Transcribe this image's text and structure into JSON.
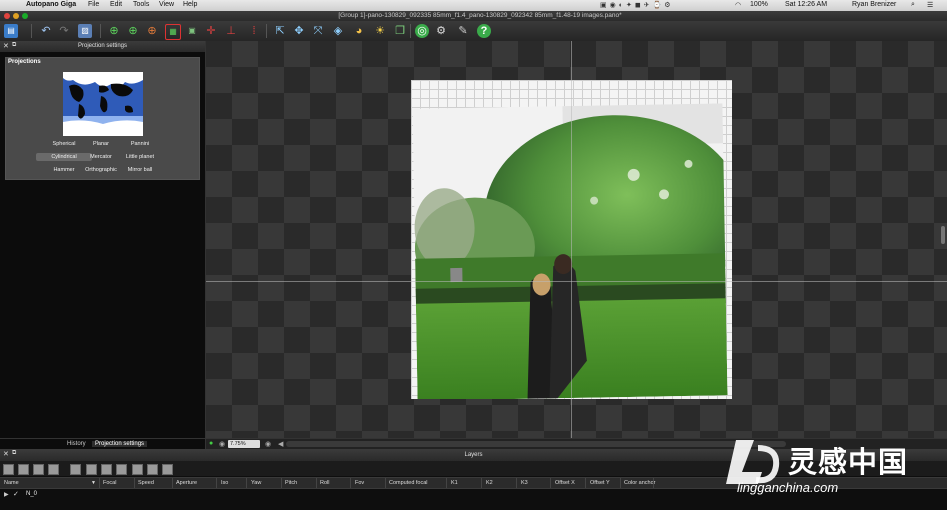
{
  "menubar": {
    "app_name": "Autopano Giga",
    "menus": [
      "File",
      "Edit",
      "Tools",
      "View",
      "Help"
    ],
    "battery": "100%",
    "datetime": "Sat 12:26 AM",
    "user": "Ryan Brenizer"
  },
  "window": {
    "title": "[Group 1]-pano-130829_092335 85mm_f1.4_pano-130829_092342 85mm_f1.48-19 images.pano*"
  },
  "left_panel": {
    "title": "Projection settings",
    "section_label": "Projections",
    "projections": [
      "Spherical",
      "Planar",
      "Pannini",
      "Cylindrical",
      "Mercator",
      "Little planet",
      "Hammer",
      "Orthographic",
      "Mirror ball"
    ],
    "selected": "Cylindrical",
    "tabs": [
      "History",
      "Projection settings"
    ],
    "active_tab": "Projection settings"
  },
  "editor": {
    "zoom": "7.75%"
  },
  "layers": {
    "title": "Layers",
    "columns": [
      "Name",
      "Focal",
      "Speed",
      "Aperture",
      "Iso",
      "Yaw",
      "Pitch",
      "Roll",
      "Fov",
      "Computed focal",
      "K1",
      "K2",
      "K3",
      "Offset X",
      "Offset Y",
      "Color anchor"
    ],
    "rows": [
      {
        "name": "N_0"
      }
    ]
  },
  "watermark": {
    "brand": "灵感中国",
    "url": "lingganchina.com"
  },
  "colors": {
    "menubar": "#d9d9d9",
    "toolbar": "#2f2f2f",
    "panel": "#0c0c0c",
    "grass": "#3f8a22",
    "sky": "#f2f2f2"
  }
}
